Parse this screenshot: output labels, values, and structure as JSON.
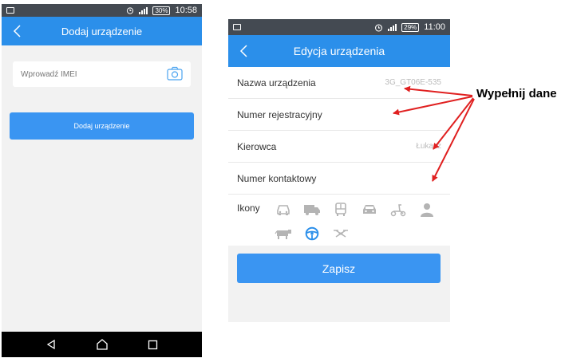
{
  "phone1": {
    "statusbar": {
      "battery": "30%",
      "time": "10:58"
    },
    "appbar": {
      "title": "Dodaj urządzenie"
    },
    "imei": {
      "placeholder": "Wprowadź IMEI",
      "value": ""
    },
    "add_button": {
      "label": "Dodaj urządzenie"
    },
    "navbar": {
      "icons": [
        "back-triangle-icon",
        "home-icon",
        "recents-icon"
      ]
    }
  },
  "phone2": {
    "statusbar": {
      "battery": "29%",
      "time": "11:00"
    },
    "appbar": {
      "title": "Edycja urządzenia"
    },
    "form": {
      "rows": [
        {
          "label": "Nazwa urządzenia",
          "value": "3G_GT06E-535"
        },
        {
          "label": "Numer rejestracyjny",
          "value": ""
        },
        {
          "label": "Kierowca",
          "value": "Łukasz"
        },
        {
          "label": "Numer kontaktowy",
          "value": ""
        }
      ],
      "icons_label": "Ikony",
      "icons": [
        "car-icon",
        "truck-icon",
        "bus-icon",
        "car-front-icon",
        "scooter-icon",
        "person-icon",
        "cow-icon",
        "steering-wheel-icon",
        "drone-icon"
      ],
      "selected_icon": "steering-wheel-icon"
    },
    "save_button": {
      "label": "Zapisz"
    }
  },
  "annotation": {
    "text": "Wypełnij dane"
  },
  "colors": {
    "accent": "#2b8fea",
    "button": "#3a95f2",
    "arrow": "#e02020",
    "statusbar": "#444a52",
    "icon_gray": "#b4b4b4"
  }
}
